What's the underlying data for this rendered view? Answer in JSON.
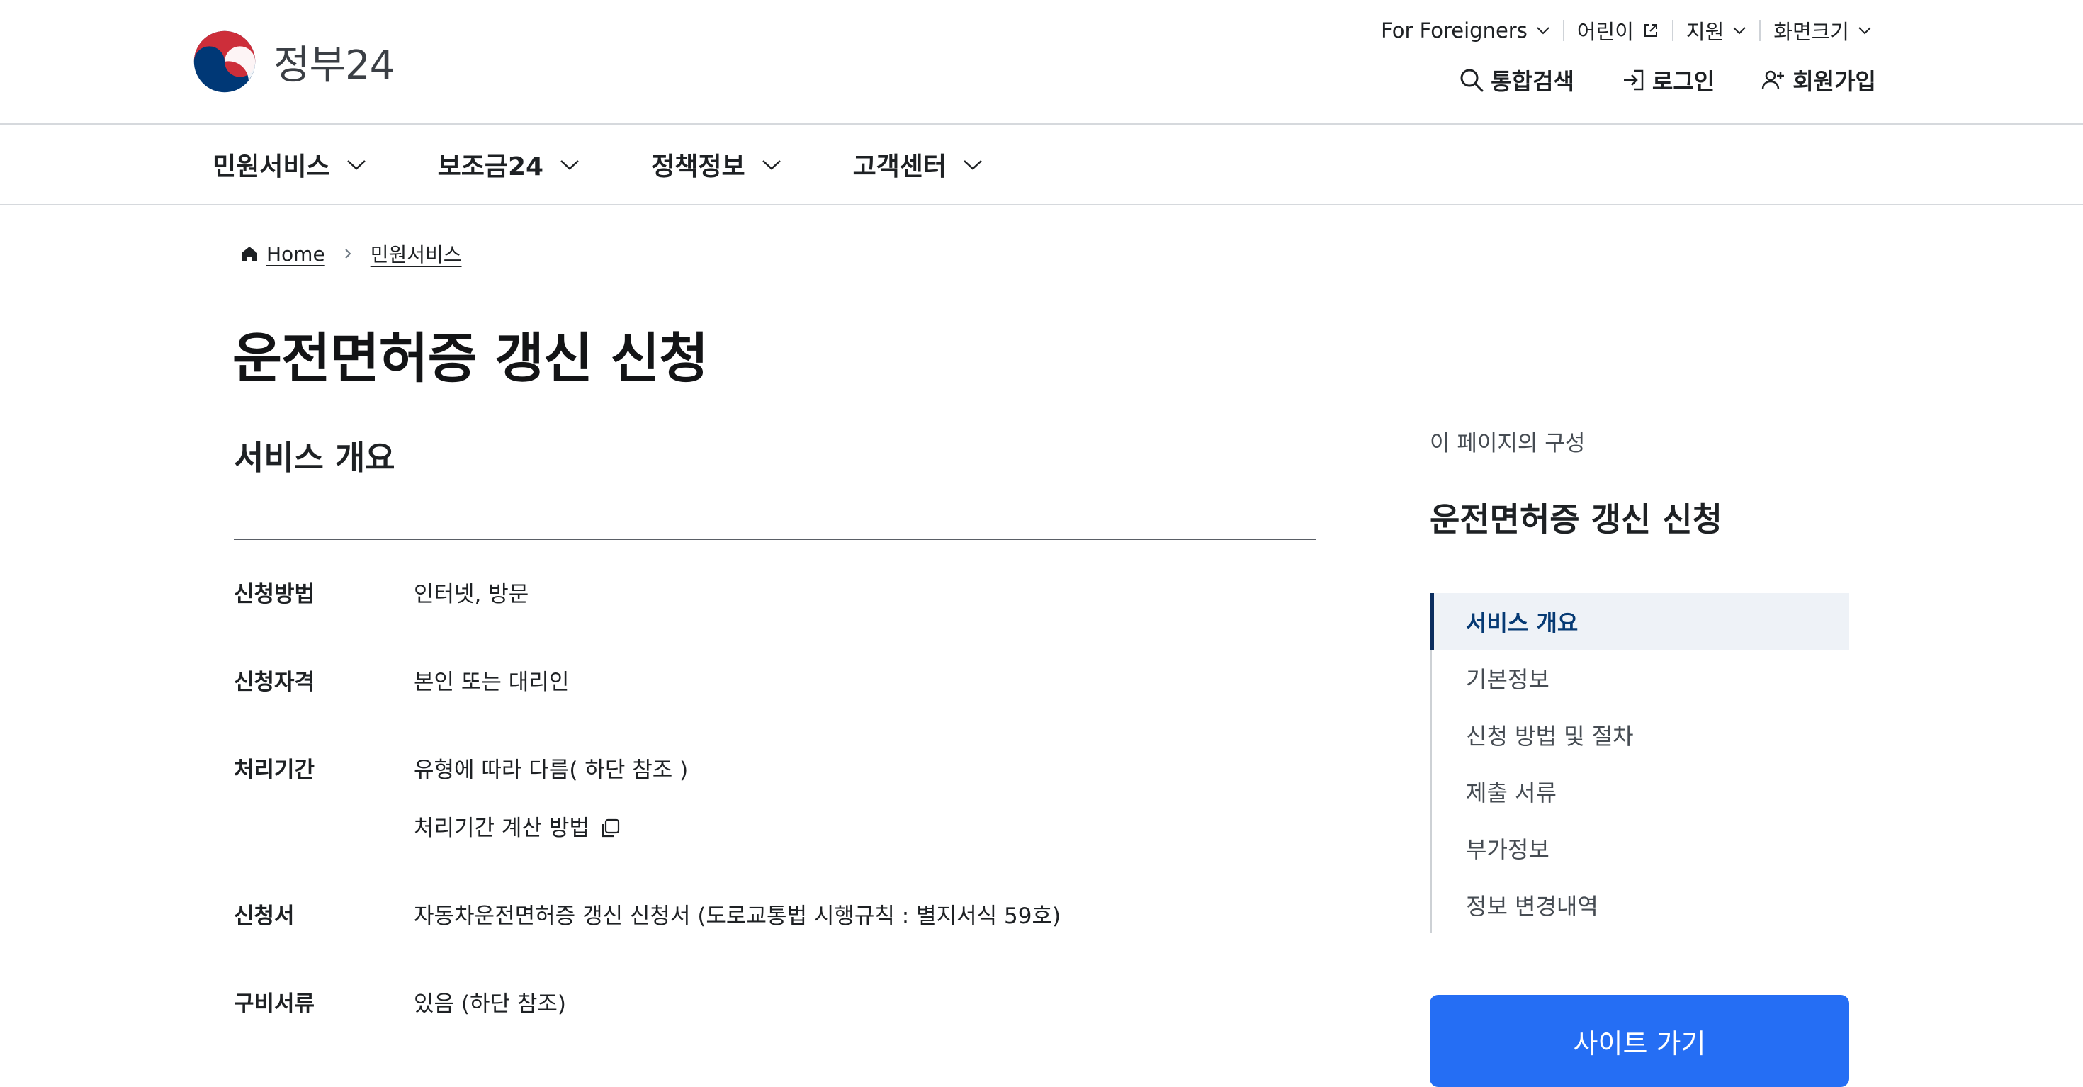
{
  "header": {
    "logo_text": "정부24",
    "util": {
      "foreigners": "For Foreigners",
      "kids": "어린이",
      "support": "지원",
      "font_size": "화면크기"
    },
    "account": {
      "search": "통합검색",
      "login": "로그인",
      "signup": "회원가입"
    }
  },
  "gnb": {
    "items": [
      "민원서비스",
      "보조금24",
      "정책정보",
      "고객센터"
    ]
  },
  "breadcrumb": {
    "home": "Home",
    "current": "민원서비스"
  },
  "page": {
    "title": "운전면허증 갱신 신청",
    "section_title": "서비스 개요"
  },
  "info": {
    "apply_method": {
      "label": "신청방법",
      "value": "인터넷, 방문"
    },
    "eligibility": {
      "label": "신청자격",
      "value": "본인 또는 대리인"
    },
    "period": {
      "label": "처리기간",
      "value": "유형에 따라 다름( 하단 참조 )",
      "link": "처리기간 계산 방법"
    },
    "form": {
      "label": "신청서",
      "value": "자동차운전면허증 갱신 신청서 (도로교통법 시행규칙 : 별지서식 59호)"
    },
    "documents": {
      "label": "구비서류",
      "value": "있음 (하단 참조)"
    }
  },
  "toc": {
    "caption": "이 페이지의 구성",
    "title": "운전면허증 갱신 신청",
    "items": [
      "서비스 개요",
      "기본정보",
      "신청 방법 및 절차",
      "제출 서류",
      "부가정보",
      "정보 변경내역"
    ],
    "active_index": 0
  },
  "site_button": "사이트 가기",
  "colors": {
    "primary": "#256ef4",
    "toc_active_bg": "#eef2f7",
    "toc_active_text": "#063a74",
    "text": "#1e2124"
  },
  "icons": {
    "logo": "taegeuk-logo-icon",
    "search": "search-icon",
    "login": "login-icon",
    "signup": "user-plus-icon",
    "home": "home-icon",
    "external": "external-link-icon",
    "copy": "copy-icon"
  }
}
